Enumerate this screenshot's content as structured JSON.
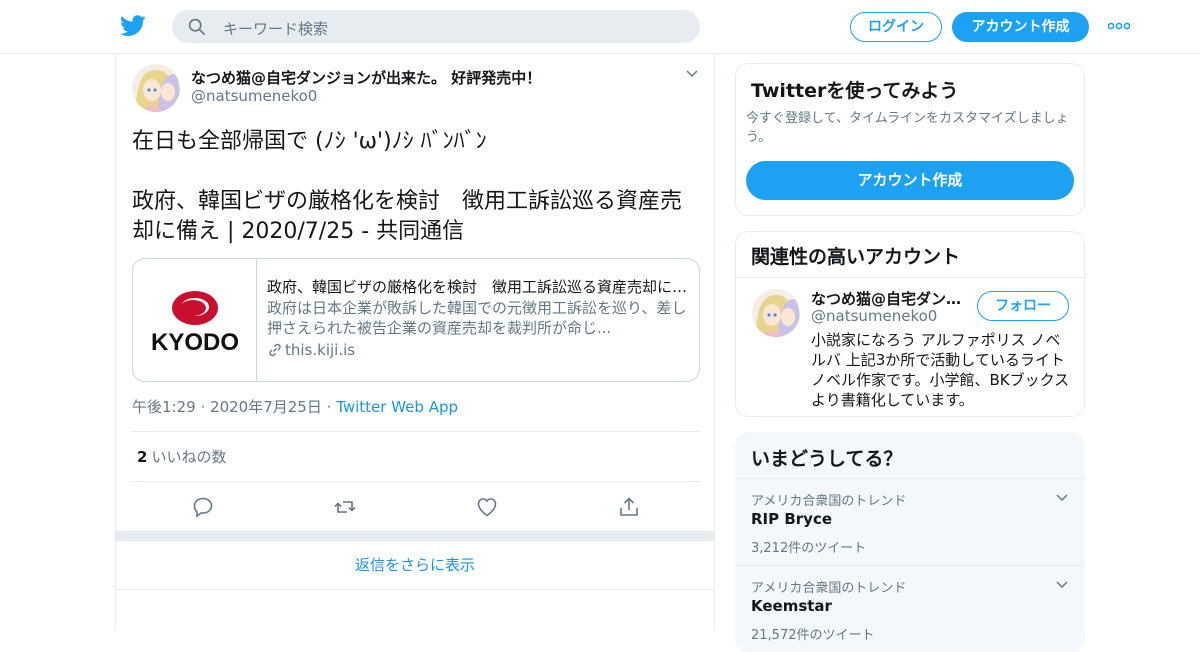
{
  "header": {
    "search_placeholder": "キーワード検索",
    "login_label": "ログイン",
    "signup_label": "アカウント作成"
  },
  "tweet": {
    "author_name": "なつめ猫@自宅ダンジョンが出来た。 好評発売中！",
    "author_handle": "@natsumeneko0",
    "text": "在日も全部帰国で (ﾉｼ 'ω')ﾉｼ ﾊﾞﾝﾊﾞﾝ\n\n政府、韓国ビザの厳格化を検討　徴用工訴訟巡る資産売却に備え | 2020/7/25 - 共同通信",
    "card": {
      "logo_text": "KYODO",
      "title": "政府、韓国ビザの厳格化を検討　徴用工訴訟巡る資産売却に備え",
      "description": "政府は日本企業が敗訴した韓国での元徴用工訴訟を巡り、差し押さえられた被告企業の資産売却を裁判所が命じ...",
      "domain": "this.kiji.is"
    },
    "time": "午後1:29",
    "date": "2020年7月25日",
    "dot": "·",
    "source": "Twitter Web App",
    "likes_count": "2",
    "likes_label": "いいねの数",
    "more_replies": "返信をさらに表示"
  },
  "signup_box": {
    "title": "Twitterを使ってみよう",
    "subtitle": "今すぐ登録して、タイムラインをカスタマイズしましょう。",
    "button": "アカウント作成"
  },
  "related": {
    "title": "関連性の高いアカウント",
    "name": "なつめ猫@自宅ダンジョンが出来た。 好評発売中！",
    "handle": "@natsumeneko0",
    "follow_label": "フォロー",
    "bio": "小説家になろう アルファポリス ノベルバ 上記3か所で活動しているライトノベル作家です。小学館、BKブックスより書籍化しています。"
  },
  "trends": {
    "title": "いまどうしてる？",
    "items": [
      {
        "context": "アメリカ合衆国のトレンド",
        "name": "RIP Bryce",
        "count": "3,212件のツイート"
      },
      {
        "context": "アメリカ合衆国のトレンド",
        "name": "Keemstar",
        "count": "21,572件のツイート"
      }
    ]
  },
  "colors": {
    "accent": "#1da1f2",
    "link": "#1b95e0",
    "muted": "#657786",
    "border": "#e6ecf0",
    "kyodo_red": "#c8102e"
  },
  "icons": [
    "twitter-bird-icon",
    "search-icon",
    "more-dots-icon",
    "chevron-down-icon",
    "link-icon",
    "reply-icon",
    "retweet-icon",
    "like-icon",
    "share-icon"
  ]
}
